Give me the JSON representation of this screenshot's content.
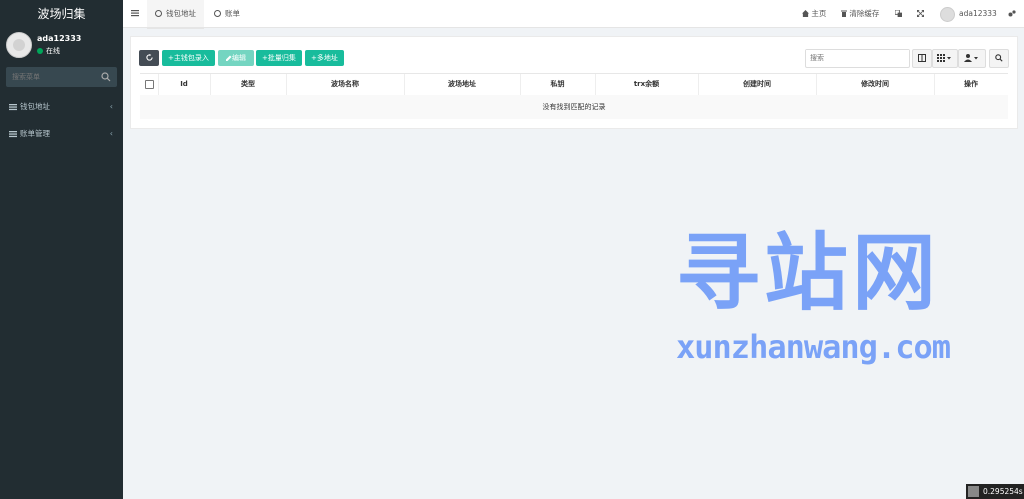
{
  "app": {
    "brand": "波场归集"
  },
  "user": {
    "name": "ada12333",
    "status": "在线"
  },
  "sidebar": {
    "search_placeholder": "搜索菜单",
    "items": [
      {
        "label": "钱包地址",
        "chevron": "‹"
      },
      {
        "label": "账单管理",
        "chevron": "‹"
      }
    ]
  },
  "topbar": {
    "tabs": [
      {
        "label": "钱包地址"
      },
      {
        "label": "账单"
      }
    ],
    "home_label": "主页",
    "clear_cache_label": "清除缓存",
    "username": "ada12333"
  },
  "toolbar": {
    "btn_add": "+主钱包录入",
    "btn_edit": "编辑",
    "btn_batch": "+批量归集",
    "btn_multi": "+多地址",
    "search_placeholder": "搜索"
  },
  "table": {
    "columns": [
      "Id",
      "类型",
      "波场名称",
      "波场地址",
      "私钥",
      "trx余额",
      "创建时间",
      "修改时间",
      "操作"
    ],
    "empty_text": "没有找到匹配的记录"
  },
  "watermark": {
    "title": "寻站网",
    "url": "xunzhanwang.com"
  },
  "timer": {
    "value": "0.295254s"
  },
  "colors": {
    "sidebar_bg": "#222d32",
    "accent_green": "#18bc9c",
    "watermark": "#7aa2f7"
  }
}
